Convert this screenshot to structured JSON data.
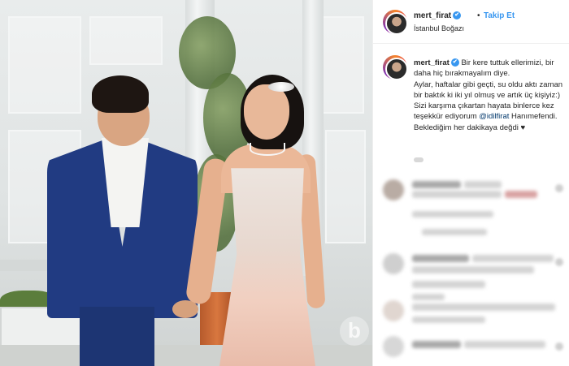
{
  "header": {
    "username": "mert_firat",
    "verified_badge": "✔",
    "separator": "•",
    "follow_label": "Takip Et",
    "location": "İstanbul Boğazı"
  },
  "post": {
    "username": "mert_firat",
    "verified_badge": "✔",
    "caption_part1": "Bir kere tuttuk ellerimizi, bir daha hiç bırakmayalım diye.\nAylar, haftalar gibi geçti, su oldu aktı zaman bir baktık ki iki yıl olmuş ve artık üç kişiyiz:) Sizi karşıma çıkartan hayata binlerce kez teşekkür ediyorum ",
    "mention": "@idilfirat",
    "caption_part2": " Hanımefendi. Beklediğim her dakikaya değdi ♥"
  },
  "photo": {
    "watermark": "b"
  },
  "colors": {
    "accent": "#3897f0",
    "mention": "#00376b",
    "text": "#262626",
    "jacket": "#213b82"
  },
  "icons": {
    "verified": "verified-check-icon",
    "avatar": "profile-avatar-icon"
  }
}
